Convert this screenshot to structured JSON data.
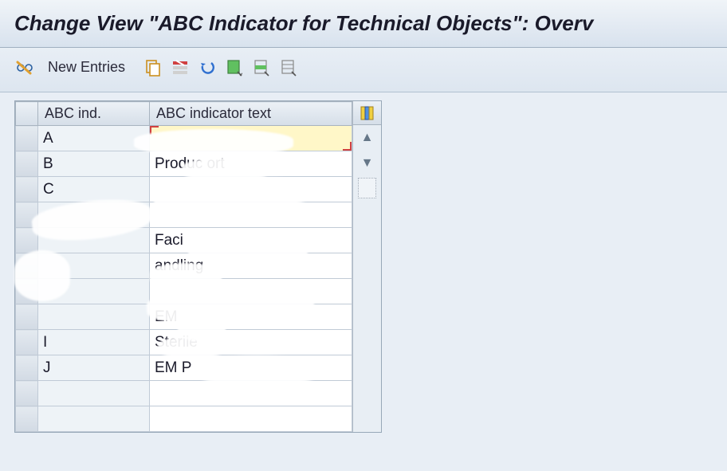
{
  "header": {
    "title": "Change View \"ABC Indicator for Technical Objects\": Overv"
  },
  "toolbar": {
    "new_entries_label": "New Entries"
  },
  "columns": {
    "ind": "ABC ind.",
    "txt": "ABC indicator text"
  },
  "rows": [
    {
      "ind": "A",
      "txt": "",
      "selected": true
    },
    {
      "ind": "B",
      "txt": "Produc            ort"
    },
    {
      "ind": "C",
      "txt": ""
    },
    {
      "ind": "",
      "txt": ""
    },
    {
      "ind": "",
      "txt": "Faci"
    },
    {
      "ind": "",
      "txt": "        andling"
    },
    {
      "ind": "",
      "txt": ""
    },
    {
      "ind": "",
      "txt": "EM"
    },
    {
      "ind": "I",
      "txt": "        Sterile"
    },
    {
      "ind": "J",
      "txt": "EM P"
    },
    {
      "ind": "",
      "txt": ""
    },
    {
      "ind": "",
      "txt": ""
    }
  ]
}
